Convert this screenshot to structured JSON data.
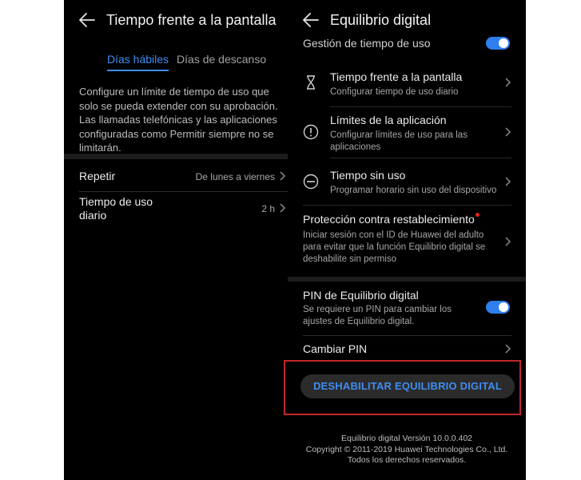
{
  "left": {
    "title": "Tiempo frente a la pantalla",
    "tabs": [
      {
        "label": "Días hábiles",
        "active": true
      },
      {
        "label": "Días de descanso",
        "active": false
      }
    ],
    "description": "Configure un límite de tiempo de uso que solo se pueda extender con su aprobación. Las llamadas telefónicas y las aplicaciones configuradas como Permitir siempre no se limitarán.",
    "rows": [
      {
        "label": "Repetir",
        "value": "De lunes a viernes"
      },
      {
        "label": "Tiempo de uso diario",
        "value": "2 h"
      }
    ]
  },
  "right": {
    "title": "Equilibrio digital",
    "partial_item": "Gestión de tiempo de uso",
    "items": [
      {
        "title": "Tiempo frente a la pantalla",
        "subtitle": "Configurar tiempo de uso diario",
        "icon": "hourglass-icon"
      },
      {
        "title": "Límites de la aplicación",
        "subtitle": "Configurar límites de uso para las aplicaciones",
        "icon": "exclamation-circle-icon"
      },
      {
        "title": "Tiempo sin uso",
        "subtitle": "Programar horario sin uso del dispositivo",
        "icon": "minus-circle-icon"
      }
    ],
    "reset_protection": {
      "title": "Protección contra restablecimiento",
      "subtitle": "Iniciar sesión con el ID de Huawei del adulto para evitar que la función Equilibrio digital se deshabilite sin permiso"
    },
    "pin": {
      "title": "PIN de Equilibrio digital",
      "subtitle": "Se requiere un PIN para cambiar los ajustes de Equilibrio digital.",
      "enabled": true
    },
    "change_pin": "Cambiar PIN",
    "disable_button": "DESHABILITAR EQUILIBRIO DIGITAL",
    "footer": {
      "version": "Equilibrio digital Versión 10.0.0.402",
      "copyright": "Copyright © 2011-2019 Huawei Technologies Co., Ltd.",
      "rights": "Todos los derechos reservados."
    }
  },
  "colors": {
    "accent": "#3f8cf2",
    "highlight": "#c0282b",
    "background": "#000000",
    "notice_dot": "#e5231d"
  }
}
